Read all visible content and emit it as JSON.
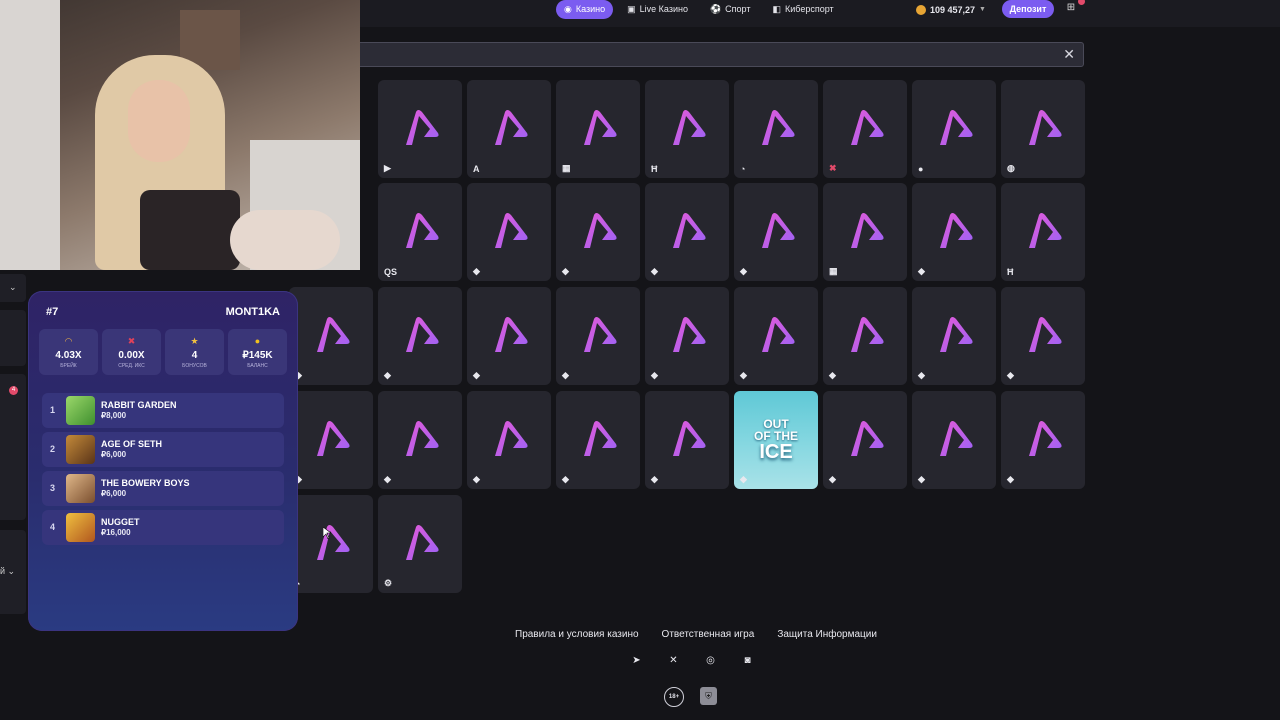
{
  "header": {
    "nav": [
      {
        "label": "Казино",
        "icon": "joystick-icon",
        "active": true
      },
      {
        "label": "Live Казино",
        "icon": "cards-icon",
        "active": false
      },
      {
        "label": "Спорт",
        "icon": "ball-icon",
        "active": false
      },
      {
        "label": "Киберспорт",
        "icon": "gamepad-icon",
        "active": false
      }
    ],
    "balance": "109 457,27",
    "deposit_label": "Депозит"
  },
  "search": {
    "value": "",
    "close_glyph": "✕"
  },
  "tiles": [
    {
      "provider_glyph": "▶"
    },
    {
      "provider_glyph": "A"
    },
    {
      "provider_glyph": "▦"
    },
    {
      "provider_glyph": "Ħ"
    },
    {
      "provider_glyph": "◔"
    },
    {
      "provider_glyph": "✖"
    },
    {
      "provider_glyph": "●"
    },
    {
      "provider_glyph": "◍"
    },
    {
      "provider_glyph": "QS"
    },
    {
      "provider_glyph": "◆"
    },
    {
      "provider_glyph": "◆"
    },
    {
      "provider_glyph": "◆"
    },
    {
      "provider_glyph": "◆"
    },
    {
      "provider_glyph": "▦"
    },
    {
      "provider_glyph": "◆"
    },
    {
      "provider_glyph": "Ħ"
    },
    {
      "provider_glyph": "◆"
    },
    {
      "provider_glyph": "◆"
    },
    {
      "provider_glyph": "◆"
    },
    {
      "provider_glyph": "◆"
    },
    {
      "provider_glyph": "◆"
    },
    {
      "provider_glyph": "◆"
    },
    {
      "provider_glyph": "◆"
    },
    {
      "provider_glyph": "◆"
    },
    {
      "provider_glyph": "◆"
    },
    {
      "provider_glyph": "◆"
    },
    {
      "provider_glyph": "◆"
    },
    {
      "provider_glyph": "◆"
    },
    {
      "provider_glyph": "◆"
    },
    {
      "provider_glyph": "◆"
    },
    {
      "provider_glyph": "◆",
      "featured": true,
      "art_line1": "OUT",
      "art_line2": "OF THE",
      "art_line3": "ICE"
    },
    {
      "provider_glyph": "◆"
    },
    {
      "provider_glyph": "◆"
    },
    {
      "provider_glyph": "◆"
    },
    {
      "provider_glyph": "◔"
    },
    {
      "provider_glyph": "⚙"
    }
  ],
  "leaderboard": {
    "rank": "#7",
    "player": "MONT1KA",
    "stats": [
      {
        "icon": "headphones-icon",
        "glyph": "🎧",
        "value": "4.03X",
        "label": "брейк"
      },
      {
        "icon": "cross-icon",
        "glyph": "✖",
        "value": "0.00X",
        "label": "сред. икс"
      },
      {
        "icon": "star-icon",
        "glyph": "★",
        "value": "4",
        "label": "бонусов"
      },
      {
        "icon": "coin-icon",
        "glyph": "●",
        "value": "₽145K",
        "label": "баланс"
      }
    ],
    "games": [
      {
        "num": "1",
        "title": "RABBIT GARDEN",
        "amount": "₽8,000",
        "thumb": "#7bc04a"
      },
      {
        "num": "2",
        "title": "AGE OF SETH",
        "amount": "₽6,000",
        "thumb": "#8a5a2a"
      },
      {
        "num": "3",
        "title": "THE BOWERY BOYS",
        "amount": "₽6,000",
        "thumb": "#b88a5a"
      },
      {
        "num": "4",
        "title": "NUGGET",
        "amount": "₽16,000",
        "thumb": "#d19a2a"
      }
    ]
  },
  "left_rail": {
    "badge": "4",
    "collapsed_label": "й"
  },
  "footer": {
    "links": [
      "Правила и условия казино",
      "Ответственная игра",
      "Защита Информации"
    ],
    "socials": [
      {
        "icon": "telegram-icon",
        "glyph": "➤"
      },
      {
        "icon": "x-icon",
        "glyph": "𝕏"
      },
      {
        "icon": "instagram-icon",
        "glyph": "◎"
      },
      {
        "icon": "discord-icon",
        "glyph": "◙"
      }
    ],
    "age_badge": "18+"
  },
  "colors": {
    "accent": "#7b5cf0",
    "tile": "#26262e",
    "logo_pink": "#e45ad8",
    "logo_purple": "#9a63f6"
  }
}
